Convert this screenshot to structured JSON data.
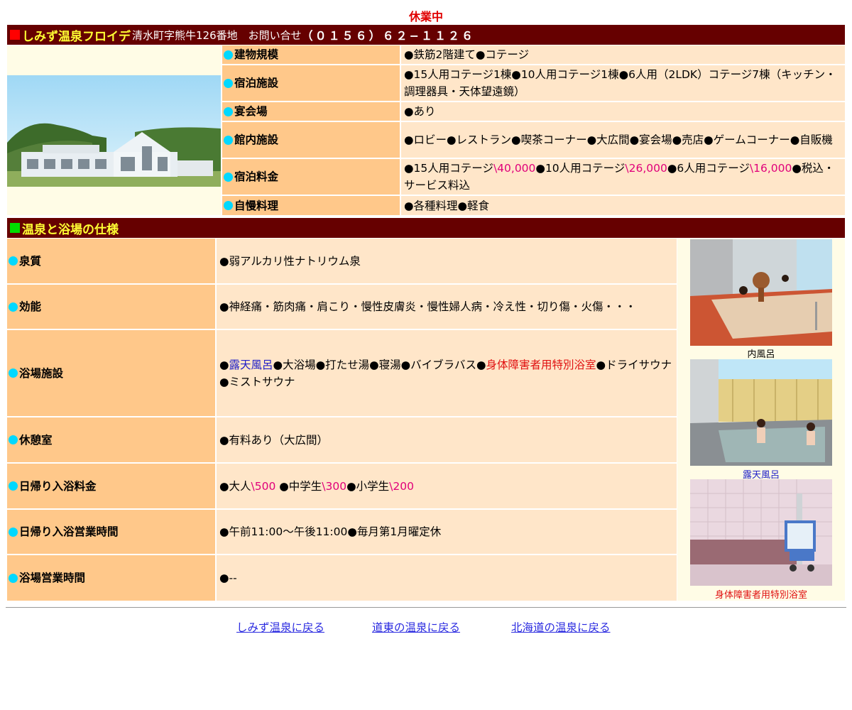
{
  "status": "休業中",
  "facility": {
    "title": "しみず温泉フロイデ",
    "address": "清水町字熊牛126番地　お問い合せ",
    "phone": "（０１５６）６２−１１２６",
    "rows": {
      "scale": {
        "label": "建物規模",
        "value": "●鉄筋2階建て●コテージ"
      },
      "lodging": {
        "label": "宿泊施設",
        "value": "●15人用コテージ1棟●10人用コテージ1棟●6人用（2LDK）コテージ7棟（キッチン・調理器具・天体望遠鏡）"
      },
      "banquet": {
        "label": "宴会場",
        "value": "●あり"
      },
      "inhouse": {
        "label": "館内施設",
        "value": "●ロビー●レストラン●喫茶コーナー●大広間●宴会場●売店●ゲームコーナー●自販機"
      },
      "fee": {
        "label": "宿泊料金",
        "p1": "●15人用コテージ",
        "v1": "\\40,000",
        "p2": "●10人用コテージ",
        "v2": "\\26,000",
        "p3": "●6人用コテージ",
        "v3": "\\16,000",
        "p4": "●税込・サービス料込"
      },
      "cuisine": {
        "label": "自慢料理",
        "value": "●各種料理●軽食"
      }
    }
  },
  "spec": {
    "title": "温泉と浴場の仕様",
    "rows": {
      "quality": {
        "label": "泉質",
        "value": "●弱アルカリ性ナトリウム泉"
      },
      "effect": {
        "label": "効能",
        "value": "●神経痛・筋肉痛・肩こり・慢性皮膚炎・慢性婦人病・冷え性・切り傷・火傷・・・"
      },
      "bath": {
        "label": "浴場施設",
        "bullet1": "●",
        "rotenburo": "露天風呂",
        "mid": "●大浴場●打たせ湯●寝湯●バイブラバス●",
        "special": "身体障害者用特別浴室",
        "tail": "●ドライサウナ●ミストサウナ"
      },
      "rest": {
        "label": "休憩室",
        "value": "●有料あり（大広間）"
      },
      "dayfee": {
        "label": "日帰り入浴料金",
        "p1": "●大人",
        "v1": "\\500",
        "p2": " ●中学生",
        "v2": "\\300",
        "p3": "●小学生",
        "v3": "\\200"
      },
      "dayhours": {
        "label": "日帰り入浴営業時間",
        "value": "●午前11:00〜午後11:00●毎月第1月曜定休"
      },
      "hours": {
        "label": "浴場営業時間",
        "value": "●--"
      }
    },
    "photos": {
      "indoor": "内風呂",
      "outdoor": "露天風呂",
      "barrierfree": "身体障害者用特別浴室"
    }
  },
  "links": {
    "shimizu": "しみず温泉に戻る",
    "doto": "道東の温泉に戻る",
    "hokkaido": "北海道の温泉に戻る"
  }
}
